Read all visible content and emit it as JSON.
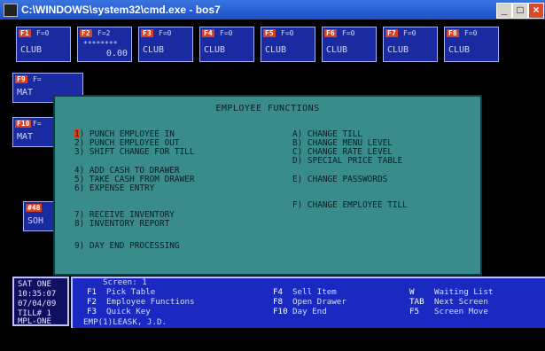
{
  "window": {
    "title": "C:\\WINDOWS\\system32\\cmd.exe - bos7",
    "minimize": "_",
    "restore": "□",
    "close": "×"
  },
  "top_keys": [
    {
      "num": "F1",
      "pad": "F=0",
      "label": "CLUB"
    },
    {
      "num": "F2",
      "pad": "F=2",
      "stars": "********",
      "amount": "0.00"
    },
    {
      "num": "F3",
      "pad": "F=0",
      "label": "CLUB"
    },
    {
      "num": "F4",
      "pad": "F=0",
      "label": "CLUB"
    },
    {
      "num": "F5",
      "pad": "F=0",
      "label": "CLUB"
    },
    {
      "num": "F6",
      "pad": "F=0",
      "label": "CLUB"
    },
    {
      "num": "F7",
      "pad": "F=0",
      "label": "CLUB"
    },
    {
      "num": "F8",
      "pad": "F=0",
      "label": "CLUB"
    }
  ],
  "left_keys": [
    {
      "num": "F9",
      "pad": "F=",
      "label": "MAT"
    },
    {
      "num": "F10",
      "pad": "F=",
      "label": "MAT"
    },
    {
      "num": "#48",
      "pad": "",
      "label": "SOH"
    }
  ],
  "dialog": {
    "title": "EMPLOYEE FUNCTIONS",
    "left_options": [
      "1) PUNCH EMPLOYEE IN",
      "2) PUNCH EMPLOYEE OUT",
      "3) SHIFT CHANGE FOR TILL",
      "4) ADD CASH TO DRAWER",
      "5) TAKE CASH FROM DRAWER",
      "6) EXPENSE ENTRY",
      "7) RECEIVE INVENTORY",
      "8) INVENTORY REPORT",
      "9) DAY END PROCESSING"
    ],
    "right_options": [
      "A) CHANGE TILL",
      "B) CHANGE MENU LEVEL",
      "C) CHANGE RATE LEVEL",
      "D) SPECIAL PRICE TABLE",
      "E) CHANGE PASSWORDS",
      "F) CHANGE EMPLOYEE TILL"
    ]
  },
  "status": {
    "day": "SAT ONE",
    "time": "10:35:07",
    "date": "07/04/09",
    "till": "TILL# 1",
    "mpl": "MPL-ONE"
  },
  "screen": {
    "title": "Screen: 1",
    "col1": [
      [
        "F1",
        "Pick Table"
      ],
      [
        "F2",
        "Employee Functions"
      ],
      [
        "F3",
        "Quick Key"
      ]
    ],
    "col2": [
      [
        "F4",
        "Sell Item"
      ],
      [
        "F8",
        "Open Drawer"
      ],
      [
        "F10",
        "Day End"
      ]
    ],
    "col3": [
      [
        "W",
        "Waiting List"
      ],
      [
        "TAB",
        "Next Screen"
      ],
      [
        "F5",
        "Screen Move"
      ]
    ],
    "employee": "EMP(1)LEASK, J.D."
  }
}
